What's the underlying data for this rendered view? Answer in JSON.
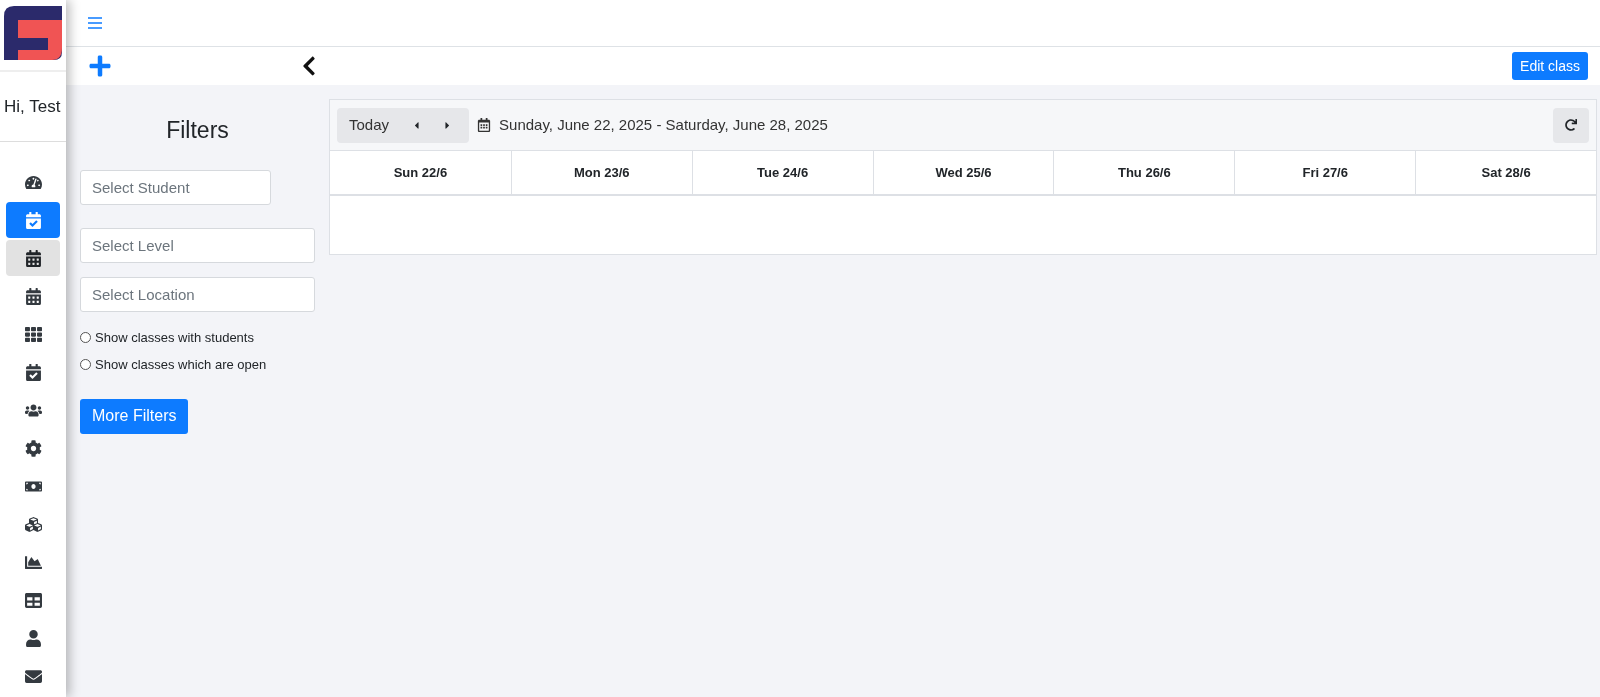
{
  "sidebar": {
    "greeting": "Hi, Test",
    "items": [
      {
        "selected": false,
        "highlighted": false
      },
      {
        "selected": true,
        "highlighted": false
      },
      {
        "selected": false,
        "highlighted": true
      },
      {
        "selected": false,
        "highlighted": false
      },
      {
        "selected": false,
        "highlighted": false
      },
      {
        "selected": false,
        "highlighted": false
      },
      {
        "selected": false,
        "highlighted": false
      },
      {
        "selected": false,
        "highlighted": false
      },
      {
        "selected": false,
        "highlighted": false
      },
      {
        "selected": false,
        "highlighted": false
      },
      {
        "selected": false,
        "highlighted": false
      },
      {
        "selected": false,
        "highlighted": false
      },
      {
        "selected": false,
        "highlighted": false
      },
      {
        "selected": false,
        "highlighted": false
      }
    ]
  },
  "toolbar": {
    "edit_button": "Edit class"
  },
  "filters": {
    "title": "Filters",
    "fields": [
      {
        "placeholder": "Select Student",
        "kind": "short"
      },
      {
        "placeholder": "Select Level",
        "kind": "wide"
      },
      {
        "placeholder": "Select Location",
        "kind": "wide"
      }
    ],
    "options": [
      {
        "label": "Show classes with students",
        "checked": false
      },
      {
        "label": "Show classes which are open",
        "checked": false
      }
    ],
    "more_button": "More Filters"
  },
  "calendar": {
    "today_button": "Today",
    "date_range": "Sunday, June 22, 2025 - Saturday, June 28, 2025",
    "days": [
      "Sun 22/6",
      "Mon 23/6",
      "Tue 24/6",
      "Wed 25/6",
      "Thu 26/6",
      "Fri 27/6",
      "Sat 28/6"
    ]
  }
}
